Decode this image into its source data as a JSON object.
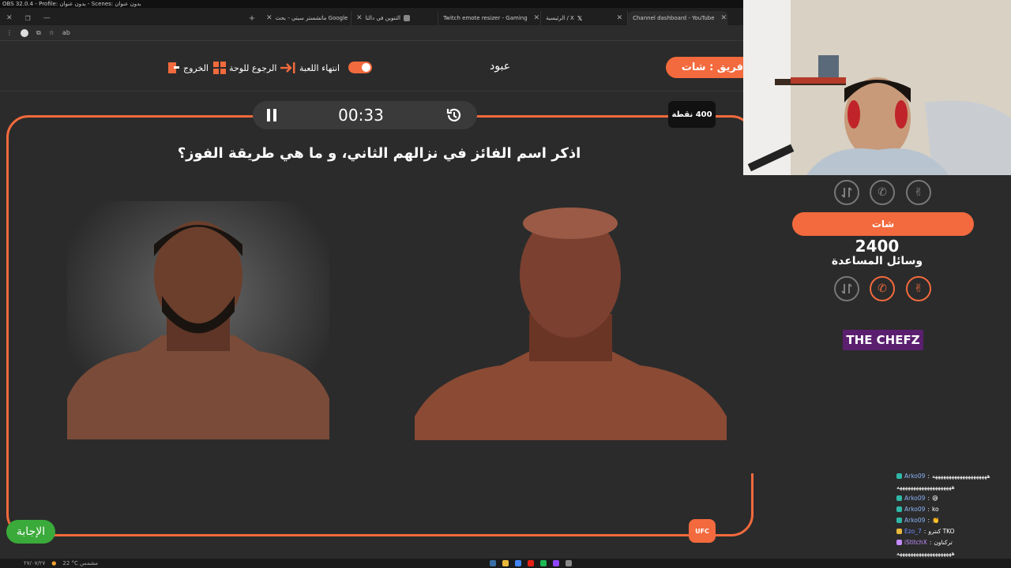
{
  "obs_title": "OBS 32.0.4 - Profile: بدون عنوان - Scenes: بدون عنوان",
  "tabs": [
    {
      "label": "Channel dashboard - YouTube",
      "color": "#e62117"
    },
    {
      "label": "الرئيسية / X",
      "color": "#000000"
    },
    {
      "label": "Twitch emote resizer - Gaming",
      "color": "#555555"
    },
    {
      "label": "التنوين في دالتا",
      "color": "#888888"
    },
    {
      "label": "ماتشستر سيتي - بحث Google",
      "color": "#4285f4"
    }
  ],
  "address": "ab",
  "header": {
    "team_pill": "ر فريق : شات",
    "player_name": "عبود",
    "end_game": "انتهاء اللعبة",
    "back_to_board": "الرجوع للوحة",
    "exit": "الخروج"
  },
  "timer": {
    "time": "00:33"
  },
  "points": "400 نقطة",
  "question": "اذكر اسم الفائز في نزالهم الثاني، و ما هي طريقة الفوز؟",
  "answer_button": "الإجابة",
  "category_badge": "UFC",
  "side": {
    "team_label": "شات",
    "score": "2400",
    "help_label": "وسائل المساعدة",
    "sponsor": "THE CHEFZ",
    "sponsor_colors": {
      "accent": "#f26a3d",
      "bg": "#5a1f6e"
    }
  },
  "chat": [
    {
      "user": "Arko09",
      "msg": "ههههههههههههههههههههه",
      "user_color": "#8ab4f8"
    },
    {
      "user": "",
      "msg": "ههههههههههههههههههههه",
      "user_color": "#8ab4f8"
    },
    {
      "user": "Arko09",
      "msg": "😅",
      "user_color": "#8ab4f8"
    },
    {
      "user": "Arko09",
      "msg": "ko",
      "user_color": "#8ab4f8"
    },
    {
      "user": "Arko09",
      "msg": "👏",
      "user_color": "#8ab4f8"
    },
    {
      "user": "Ezo_7",
      "msg": "كنترو TKO",
      "user_color": "#6c8cff"
    },
    {
      "user": "iStitchX",
      "msg": "تركناون",
      "user_color": "#c38cff"
    },
    {
      "user": "",
      "msg": "ههههههههههههههههههههه",
      "user_color": "#8ab4f8"
    }
  ],
  "taskbar": {
    "weather": "22 °C مشمس",
    "date": "٢٧/٠٧/٢٧"
  },
  "colors": {
    "accent": "#f26a3d",
    "bg": "#2b2b2b",
    "answer": "#3aaa3a"
  }
}
